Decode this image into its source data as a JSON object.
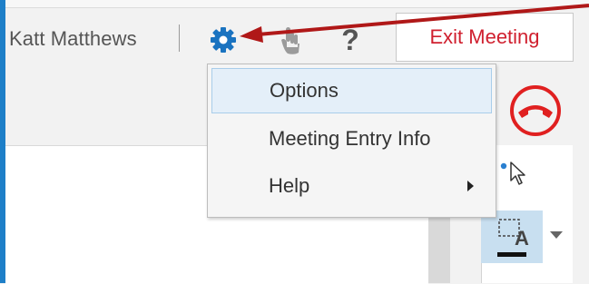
{
  "header": {
    "user_name": "Katt Matthews",
    "help_glyph": "?",
    "exit_label": "Exit Meeting"
  },
  "icons": {
    "settings": "gear-icon",
    "hand": "raise-hand-icon",
    "help": "help-icon",
    "hangup": "hang-up-icon",
    "pointer": "pointer-tool-icon",
    "text": "text-tool-icon",
    "submenu": "chevron-right-icon"
  },
  "menu": {
    "items": [
      {
        "label": "Options",
        "selected": true
      },
      {
        "label": "Meeting Entry Info",
        "selected": false
      },
      {
        "label": "Help",
        "has_submenu": true
      }
    ]
  },
  "tools": {
    "text_tool_letter": "A"
  },
  "colors": {
    "accent_blue": "#1e7fc8",
    "exit_red": "#d0202f",
    "annotation_arrow": "#b01818",
    "menu_selection": "#e4eff9"
  }
}
